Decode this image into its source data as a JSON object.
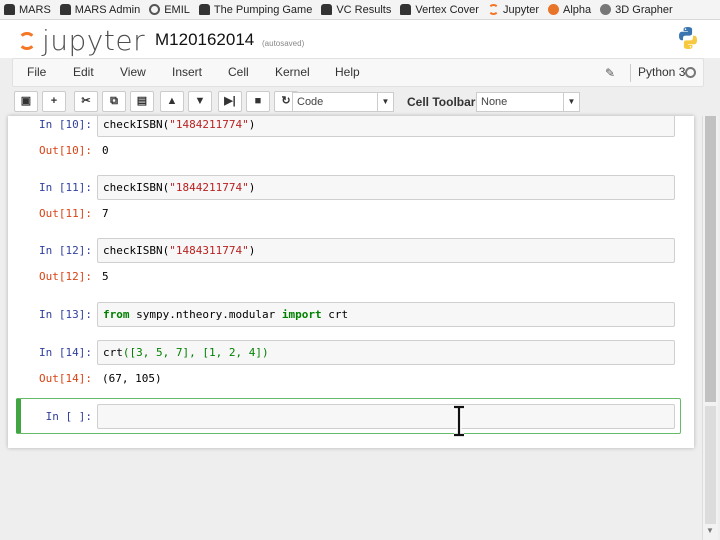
{
  "bookmarks": [
    {
      "label": "MARS",
      "icon": "car-icon"
    },
    {
      "label": "MARS Admin",
      "icon": "car-icon"
    },
    {
      "label": "EMIL",
      "icon": "emil-icon"
    },
    {
      "label": "The Pumping Game",
      "icon": "car-icon"
    },
    {
      "label": "VC Results",
      "icon": "car-icon"
    },
    {
      "label": "Vertex Cover",
      "icon": "car-icon"
    },
    {
      "label": "Jupyter",
      "icon": "jupyter-icon"
    },
    {
      "label": "Alpha",
      "icon": "alpha-icon"
    },
    {
      "label": "3D Grapher",
      "icon": "grapher-icon"
    }
  ],
  "header": {
    "logo_text": "jupyter",
    "notebook_title": "M120162014",
    "save_status": "(autosaved)"
  },
  "menu": {
    "items": [
      "File",
      "Edit",
      "View",
      "Insert",
      "Cell",
      "Kernel",
      "Help"
    ],
    "kernel_name": "Python 3"
  },
  "toolbar": {
    "buttons": [
      {
        "name": "save-button",
        "glyph": "▣"
      },
      {
        "name": "insert-cell-button",
        "glyph": "+"
      },
      {
        "name": "cut-button",
        "glyph": "✂"
      },
      {
        "name": "copy-button",
        "glyph": "⧉"
      },
      {
        "name": "paste-button",
        "glyph": "▤"
      },
      {
        "name": "move-up-button",
        "glyph": "▲"
      },
      {
        "name": "move-down-button",
        "glyph": "▼"
      },
      {
        "name": "run-button",
        "glyph": "▶|"
      },
      {
        "name": "stop-button",
        "glyph": "■"
      },
      {
        "name": "restart-button",
        "glyph": "↻"
      }
    ],
    "cell_type": "Code",
    "cell_toolbar_label": "Cell Toolbar:",
    "cell_toolbar_value": "None"
  },
  "cells": {
    "c10": {
      "in": "In [10]:",
      "code_fn": "checkISBN(",
      "code_arg": "\"1484211774\"",
      "code_end": ")",
      "out": "Out[10]:",
      "result": "0"
    },
    "c11": {
      "in": "In [11]:",
      "code_fn": "checkISBN(",
      "code_arg": "\"1844211774\"",
      "code_end": ")",
      "out": "Out[11]:",
      "result": "7"
    },
    "c12": {
      "in": "In [12]:",
      "code_fn": "checkISBN(",
      "code_arg": "\"1484311774\"",
      "code_end": ")",
      "out": "Out[12]:",
      "result": "5"
    },
    "c13": {
      "in": "In [13]:",
      "kw_from": "from",
      "module": " sympy.ntheory.modular ",
      "kw_import": "import",
      "name": " crt"
    },
    "c14": {
      "in": "In [14]:",
      "code_fn": "crt",
      "code_args": "([3, 5, 7], [1, 2, 4])",
      "out": "Out[14]:",
      "result": "(67, 105)"
    },
    "empty": {
      "in": "In [ ]:"
    }
  }
}
